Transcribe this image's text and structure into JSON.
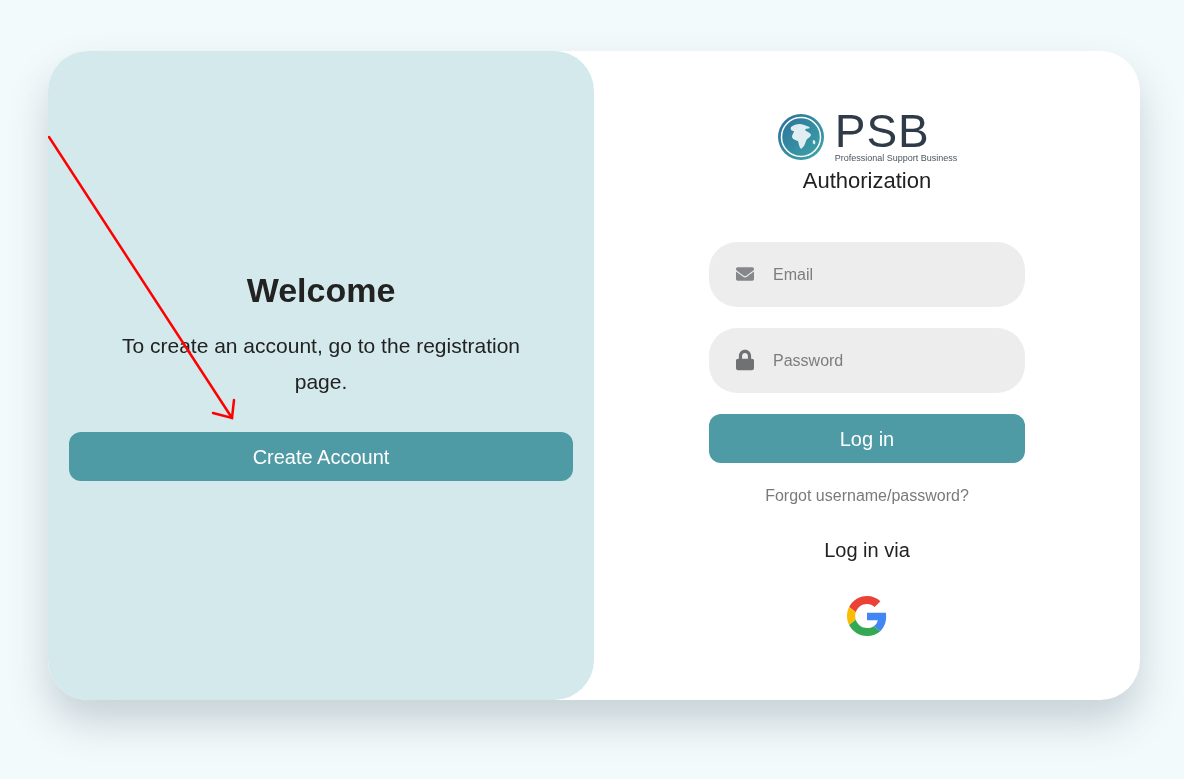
{
  "welcome_panel": {
    "title": "Welcome",
    "message": "To create an account, go to the registration page.",
    "button": "Create Account"
  },
  "login_panel": {
    "logo": {
      "text": "PSB",
      "tagline": "Professional Support Business"
    },
    "title": "Authorization",
    "fields": [
      {
        "kind": "email",
        "placeholder": "Email"
      },
      {
        "kind": "password",
        "placeholder": "Password"
      }
    ],
    "submit_button": "Log in",
    "forgot_link": "Forgot username/password?",
    "social_label": "Log in via"
  }
}
